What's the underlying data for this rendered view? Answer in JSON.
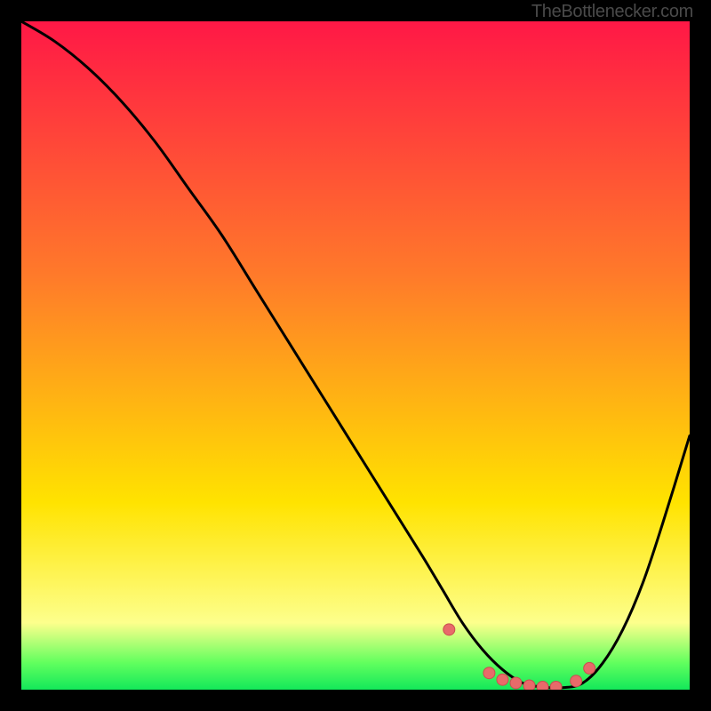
{
  "watermark": "TheBottlenecker.com",
  "colors": {
    "gradient_top": "#ff1846",
    "gradient_mid1": "#ff7a2a",
    "gradient_mid2": "#ffe300",
    "gradient_bottom_band_top": "#fdff8c",
    "gradient_bottom_band_mid": "#61ff5e",
    "gradient_bottom_band_low": "#13e85a",
    "curve": "#000000",
    "marker_fill": "#e86a6a",
    "marker_stroke": "#c94f4f",
    "frame": "#000000"
  },
  "chart_data": {
    "type": "line",
    "title": "",
    "xlabel": "",
    "ylabel": "",
    "xlim": [
      0,
      100
    ],
    "ylim": [
      0,
      100
    ],
    "series": [
      {
        "name": "bottleneck-curve",
        "x": [
          0,
          5,
          10,
          15,
          20,
          25,
          30,
          35,
          40,
          45,
          50,
          55,
          60,
          63,
          66,
          69,
          72,
          75,
          78,
          81,
          84,
          87,
          90,
          93,
          96,
          100
        ],
        "y": [
          100,
          97,
          93,
          88,
          82,
          75,
          68,
          60,
          52,
          44,
          36,
          28,
          20,
          15,
          10,
          6,
          3,
          1,
          0.4,
          0.3,
          1,
          4,
          9,
          16,
          25,
          38
        ]
      }
    ],
    "markers": {
      "name": "highlight-points",
      "x": [
        64,
        70,
        72,
        74,
        76,
        78,
        80,
        83,
        85
      ],
      "y": [
        9,
        2.5,
        1.5,
        1.0,
        0.6,
        0.4,
        0.4,
        1.3,
        3.2
      ]
    }
  }
}
